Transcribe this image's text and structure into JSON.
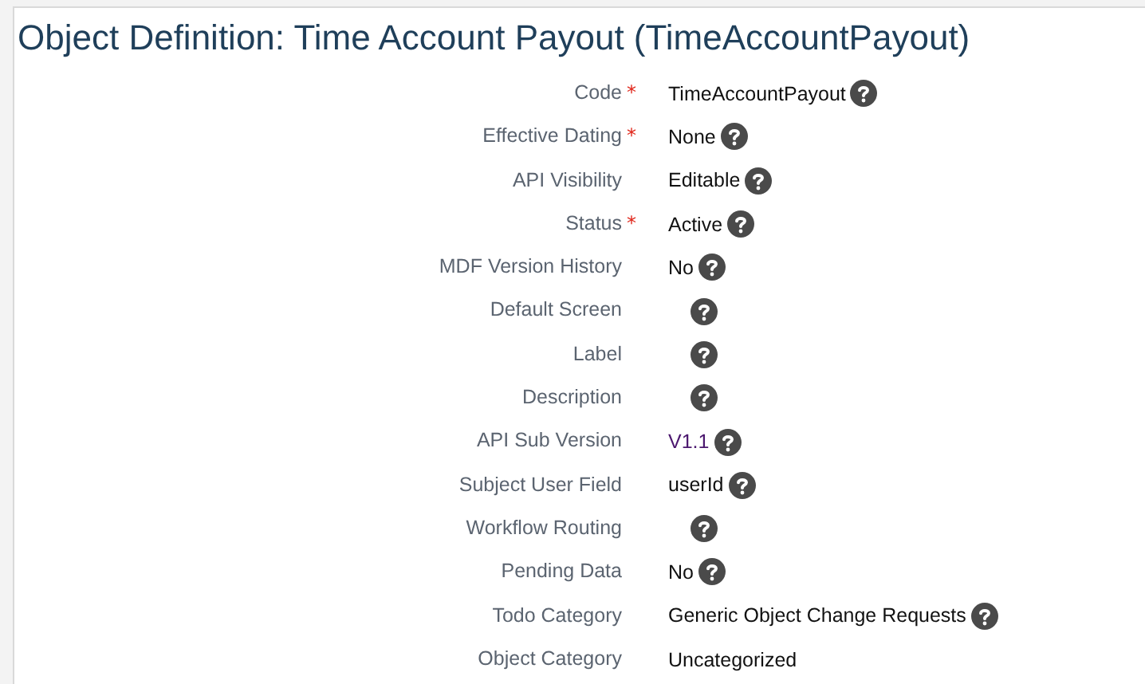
{
  "title": "Object Definition: Time Account Payout (TimeAccountPayout)",
  "fields": [
    {
      "label": "Code",
      "required_mark": "*",
      "value": "TimeAccountPayout",
      "kind": "text",
      "help": true
    },
    {
      "label": "Effective Dating",
      "required_mark": "*",
      "value": "None",
      "kind": "text",
      "help": true
    },
    {
      "label": "API Visibility",
      "value": "Editable",
      "kind": "text",
      "help": true
    },
    {
      "label": "Status",
      "required_mark": "*",
      "value": "Active",
      "kind": "text",
      "help": true
    },
    {
      "label": "MDF Version History",
      "value": "No",
      "kind": "text",
      "help": true
    },
    {
      "label": "Default Screen",
      "kind": "empty",
      "help": true
    },
    {
      "label": "Label",
      "kind": "empty",
      "help": true
    },
    {
      "label": "Description",
      "kind": "empty",
      "help": true
    },
    {
      "label": "API Sub Version",
      "value": "V1.1",
      "kind": "link",
      "help": true
    },
    {
      "label": "Subject User Field",
      "value": "userId",
      "kind": "text",
      "help": true
    },
    {
      "label": "Workflow Routing",
      "kind": "empty",
      "help": true
    },
    {
      "label": "Pending Data",
      "value": "No",
      "kind": "text",
      "help": true
    },
    {
      "label": "Todo Category",
      "value": "Generic Object Change Requests",
      "kind": "text",
      "help": true
    },
    {
      "label": "Object Category",
      "value": "Uncategorized",
      "kind": "text",
      "help": false
    }
  ]
}
